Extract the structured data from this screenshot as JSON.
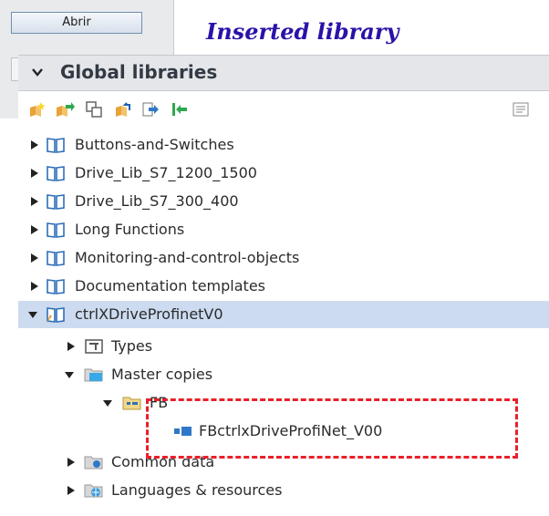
{
  "topPanel": {
    "open_button": "Abrir"
  },
  "caption": "Inserted library",
  "libraryHeader": {
    "title": "Global libraries",
    "chevron_icon": "chevron-down-icon"
  },
  "toolbar": {
    "items": [
      {
        "name": "new-library-icon"
      },
      {
        "name": "open-library-icon"
      },
      {
        "name": "save-library-icon"
      },
      {
        "name": "close-library-icon"
      },
      {
        "name": "export-library-icon"
      },
      {
        "name": "import-library-icon"
      },
      {
        "name": "properties-icon"
      }
    ]
  },
  "tree": [
    {
      "label": "Buttons-and-Switches",
      "expanded": false,
      "icon": "library-book-icon"
    },
    {
      "label": "Drive_Lib_S7_1200_1500",
      "expanded": false,
      "icon": "library-book-icon"
    },
    {
      "label": "Drive_Lib_S7_300_400",
      "expanded": false,
      "icon": "library-book-icon"
    },
    {
      "label": "Long Functions",
      "expanded": false,
      "icon": "library-book-icon"
    },
    {
      "label": "Monitoring-and-control-objects",
      "expanded": false,
      "icon": "library-book-icon"
    },
    {
      "label": "Documentation templates",
      "expanded": false,
      "icon": "library-book-icon"
    },
    {
      "label": "ctrlXDriveProfinetV0",
      "expanded": true,
      "selected": true,
      "icon": "library-open-icon"
    },
    {
      "label": "Types",
      "expanded": false,
      "icon": "types-folder-icon"
    },
    {
      "label": "Master copies",
      "expanded": true,
      "icon": "folder-icon"
    },
    {
      "label": "FB",
      "expanded": true,
      "icon": "fb-folder-icon"
    },
    {
      "label": "FBctrlxDriveProfiNet_V00",
      "icon": "block-icon"
    },
    {
      "label": "Common data",
      "expanded": false,
      "icon": "common-data-icon"
    },
    {
      "label": "Languages & resources",
      "expanded": false,
      "icon": "languages-icon"
    }
  ]
}
